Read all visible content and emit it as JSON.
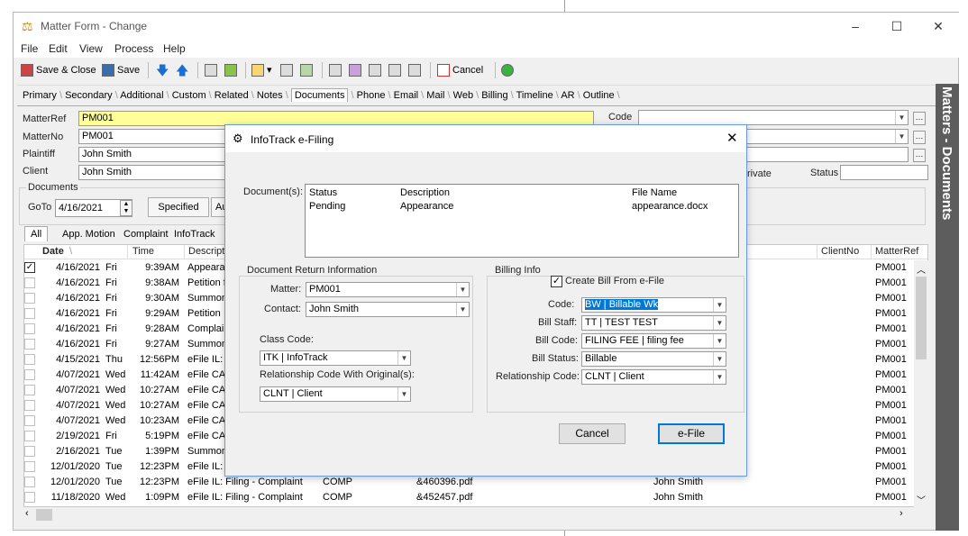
{
  "window": {
    "title": "Matter Form - Change",
    "minimize_glyph": "–",
    "maximize_glyph": "☐",
    "close_glyph": "✕"
  },
  "menu": [
    "File",
    "Edit",
    "View",
    "Process",
    "Help"
  ],
  "toolbar": {
    "save_close": "Save & Close",
    "save": "Save",
    "cancel": "Cancel"
  },
  "tabs": [
    "Primary",
    "Secondary",
    "Additional",
    "Custom",
    "Related",
    "Notes",
    "Documents",
    "Phone",
    "Email",
    "Mail",
    "Web",
    "Billing",
    "Timeline",
    "AR",
    "Outline"
  ],
  "form": {
    "matterref_label": "MatterRef",
    "matterref_value": "PM001",
    "matterno_label": "MatterNo",
    "matterno_value": "PM001",
    "plaintiff_label": "Plaintiff",
    "plaintiff_value": "John Smith",
    "client_label": "Client",
    "client_value": "John Smith",
    "code_label": "Code",
    "private_label": "rivate",
    "status_label": "Status"
  },
  "documents": {
    "group_label": "Documents",
    "goto_label": "GoTo",
    "goto_value": "4/16/2021",
    "specified_label": "Specified",
    "au_label": "Au",
    "filter_tabs": [
      "All",
      "App. Motion",
      "Complaint",
      "InfoTrack"
    ]
  },
  "grid": {
    "headers": {
      "date": "Date",
      "time": "Time",
      "desc": "Descripti",
      "clientno": "ClientNo",
      "matterref": "MatterRef"
    },
    "rows": [
      {
        "checked": true,
        "date": "4/16/2021",
        "day": "Fri",
        "time": "9:39AM",
        "desc": "Appeara",
        "c1": "",
        "c2": "",
        "c3": "",
        "ref": "PM001"
      },
      {
        "checked": false,
        "date": "4/16/2021",
        "day": "Fri",
        "time": "9:38AM",
        "desc": "Petition f",
        "c1": "",
        "c2": "",
        "c3": "",
        "ref": "PM001"
      },
      {
        "checked": false,
        "date": "4/16/2021",
        "day": "Fri",
        "time": "9:30AM",
        "desc": "Summon",
        "c1": "",
        "c2": "",
        "c3": "",
        "ref": "PM001"
      },
      {
        "checked": false,
        "date": "4/16/2021",
        "day": "Fri",
        "time": "9:29AM",
        "desc": "Petition",
        "c1": "",
        "c2": "",
        "c3": "",
        "ref": "PM001"
      },
      {
        "checked": false,
        "date": "4/16/2021",
        "day": "Fri",
        "time": "9:28AM",
        "desc": "Complair",
        "c1": "",
        "c2": "",
        "c3": "",
        "ref": "PM001"
      },
      {
        "checked": false,
        "date": "4/16/2021",
        "day": "Fri",
        "time": "9:27AM",
        "desc": "Summon",
        "c1": "",
        "c2": "",
        "c3": "",
        "ref": "PM001"
      },
      {
        "checked": false,
        "date": "4/15/2021",
        "day": "Thu",
        "time": "12:56PM",
        "desc": "eFile IL:",
        "c1": "",
        "c2": "",
        "c3": "",
        "ref": "PM001"
      },
      {
        "checked": false,
        "date": "4/07/2021",
        "day": "Wed",
        "time": "11:42AM",
        "desc": "eFile CA:",
        "c1": "",
        "c2": "",
        "c3": "",
        "ref": "PM001"
      },
      {
        "checked": false,
        "date": "4/07/2021",
        "day": "Wed",
        "time": "10:27AM",
        "desc": "eFile CA:",
        "c1": "",
        "c2": "",
        "c3": "",
        "ref": "PM001"
      },
      {
        "checked": false,
        "date": "4/07/2021",
        "day": "Wed",
        "time": "10:27AM",
        "desc": "eFile CA:",
        "c1": "",
        "c2": "",
        "c3": "",
        "ref": "PM001"
      },
      {
        "checked": false,
        "date": "4/07/2021",
        "day": "Wed",
        "time": "10:23AM",
        "desc": "eFile CA:",
        "c1": "",
        "c2": "",
        "c3": "",
        "ref": "PM001"
      },
      {
        "checked": false,
        "date": "2/19/2021",
        "day": "Fri",
        "time": "5:19PM",
        "desc": "eFile CA:",
        "c1": "",
        "c2": "",
        "c3": "",
        "ref": "PM001"
      },
      {
        "checked": false,
        "date": "2/16/2021",
        "day": "Tue",
        "time": "1:39PM",
        "desc": "Summon",
        "c1": "",
        "c2": "",
        "c3": "",
        "ref": "PM001"
      },
      {
        "checked": false,
        "date": "12/01/2020",
        "day": "Tue",
        "time": "12:23PM",
        "desc": "eFile IL:",
        "c1": "",
        "c2": "",
        "c3": "",
        "ref": "PM001"
      },
      {
        "checked": false,
        "date": "12/01/2020",
        "day": "Tue",
        "time": "12:23PM",
        "desc": "eFile IL: Filing - Complaint",
        "c1": "COMP",
        "c2": "&460396.pdf",
        "c3": "John Smith",
        "ref": "PM001"
      },
      {
        "checked": false,
        "date": "11/18/2020",
        "day": "Wed",
        "time": "1:09PM",
        "desc": "eFile IL: Filing - Complaint",
        "c1": "COMP",
        "c2": "&452457.pdf",
        "c3": "John Smith",
        "ref": "PM001"
      }
    ]
  },
  "side_panel": {
    "label": "Matters - Documents"
  },
  "dialog": {
    "title": "InfoTrack e-Filing",
    "documents_label": "Document(s):",
    "doc_headers": [
      "Status",
      "Description",
      "File Name"
    ],
    "doc_rows": [
      {
        "status": "Pending",
        "description": "Appearance",
        "file": "appearance.docx"
      }
    ],
    "doc_return_label": "Document Return Information",
    "matter_label": "Matter:",
    "matter_value": "PM001",
    "contact_label": "Contact:",
    "contact_value": "John Smith",
    "class_code_label": "Class Code:",
    "class_code_value": "ITK | InfoTrack",
    "rel_orig_label": "Relationship Code With Original(s):",
    "rel_orig_value": "CLNT | Client",
    "billing_label": "Billing Info",
    "create_bill_label": "Create Bill From e-File",
    "create_bill_checked": true,
    "code_label": "Code:",
    "code_value": "BW | Billable Wk",
    "bill_staff_label": "Bill Staff:",
    "bill_staff_value": "TT | TEST TEST",
    "bill_code_label": "Bill Code:",
    "bill_code_value": "FILING FEE | filing fee",
    "bill_status_label": "Bill Status:",
    "bill_status_value": "Billable",
    "rel_code_label": "Relationship Code:",
    "rel_code_value": "CLNT | Client",
    "cancel_button": "Cancel",
    "efile_button": "e-File",
    "close_glyph": "✕"
  },
  "colors": {
    "highlight_field": "#ffff99",
    "selection": "#0078d7",
    "side_panel": "#5d5d5d"
  }
}
